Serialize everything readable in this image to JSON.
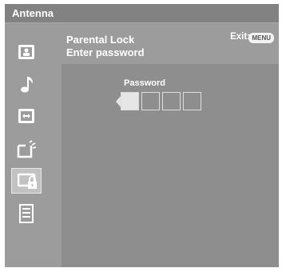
{
  "topbar": {
    "title": "Antenna"
  },
  "sidebar": {
    "items": [
      {
        "icon": "picture-icon"
      },
      {
        "icon": "music-note-icon"
      },
      {
        "icon": "screen-adjust-icon"
      },
      {
        "icon": "setup-icon"
      },
      {
        "icon": "parental-lock-icon",
        "selected": true
      },
      {
        "icon": "product-info-icon"
      }
    ]
  },
  "header": {
    "title": "Parental Lock",
    "subtitle": "Enter password",
    "exit_label": "Exit:",
    "menu_key": "MENU"
  },
  "password": {
    "label": "Password",
    "digits": [
      "",
      "",
      "",
      ""
    ],
    "active_index": 0
  },
  "colors": {
    "background": "#8e8e8e",
    "panel": "#9c9c9c",
    "topbar": "#828282",
    "highlight": "#e6e6e6"
  }
}
